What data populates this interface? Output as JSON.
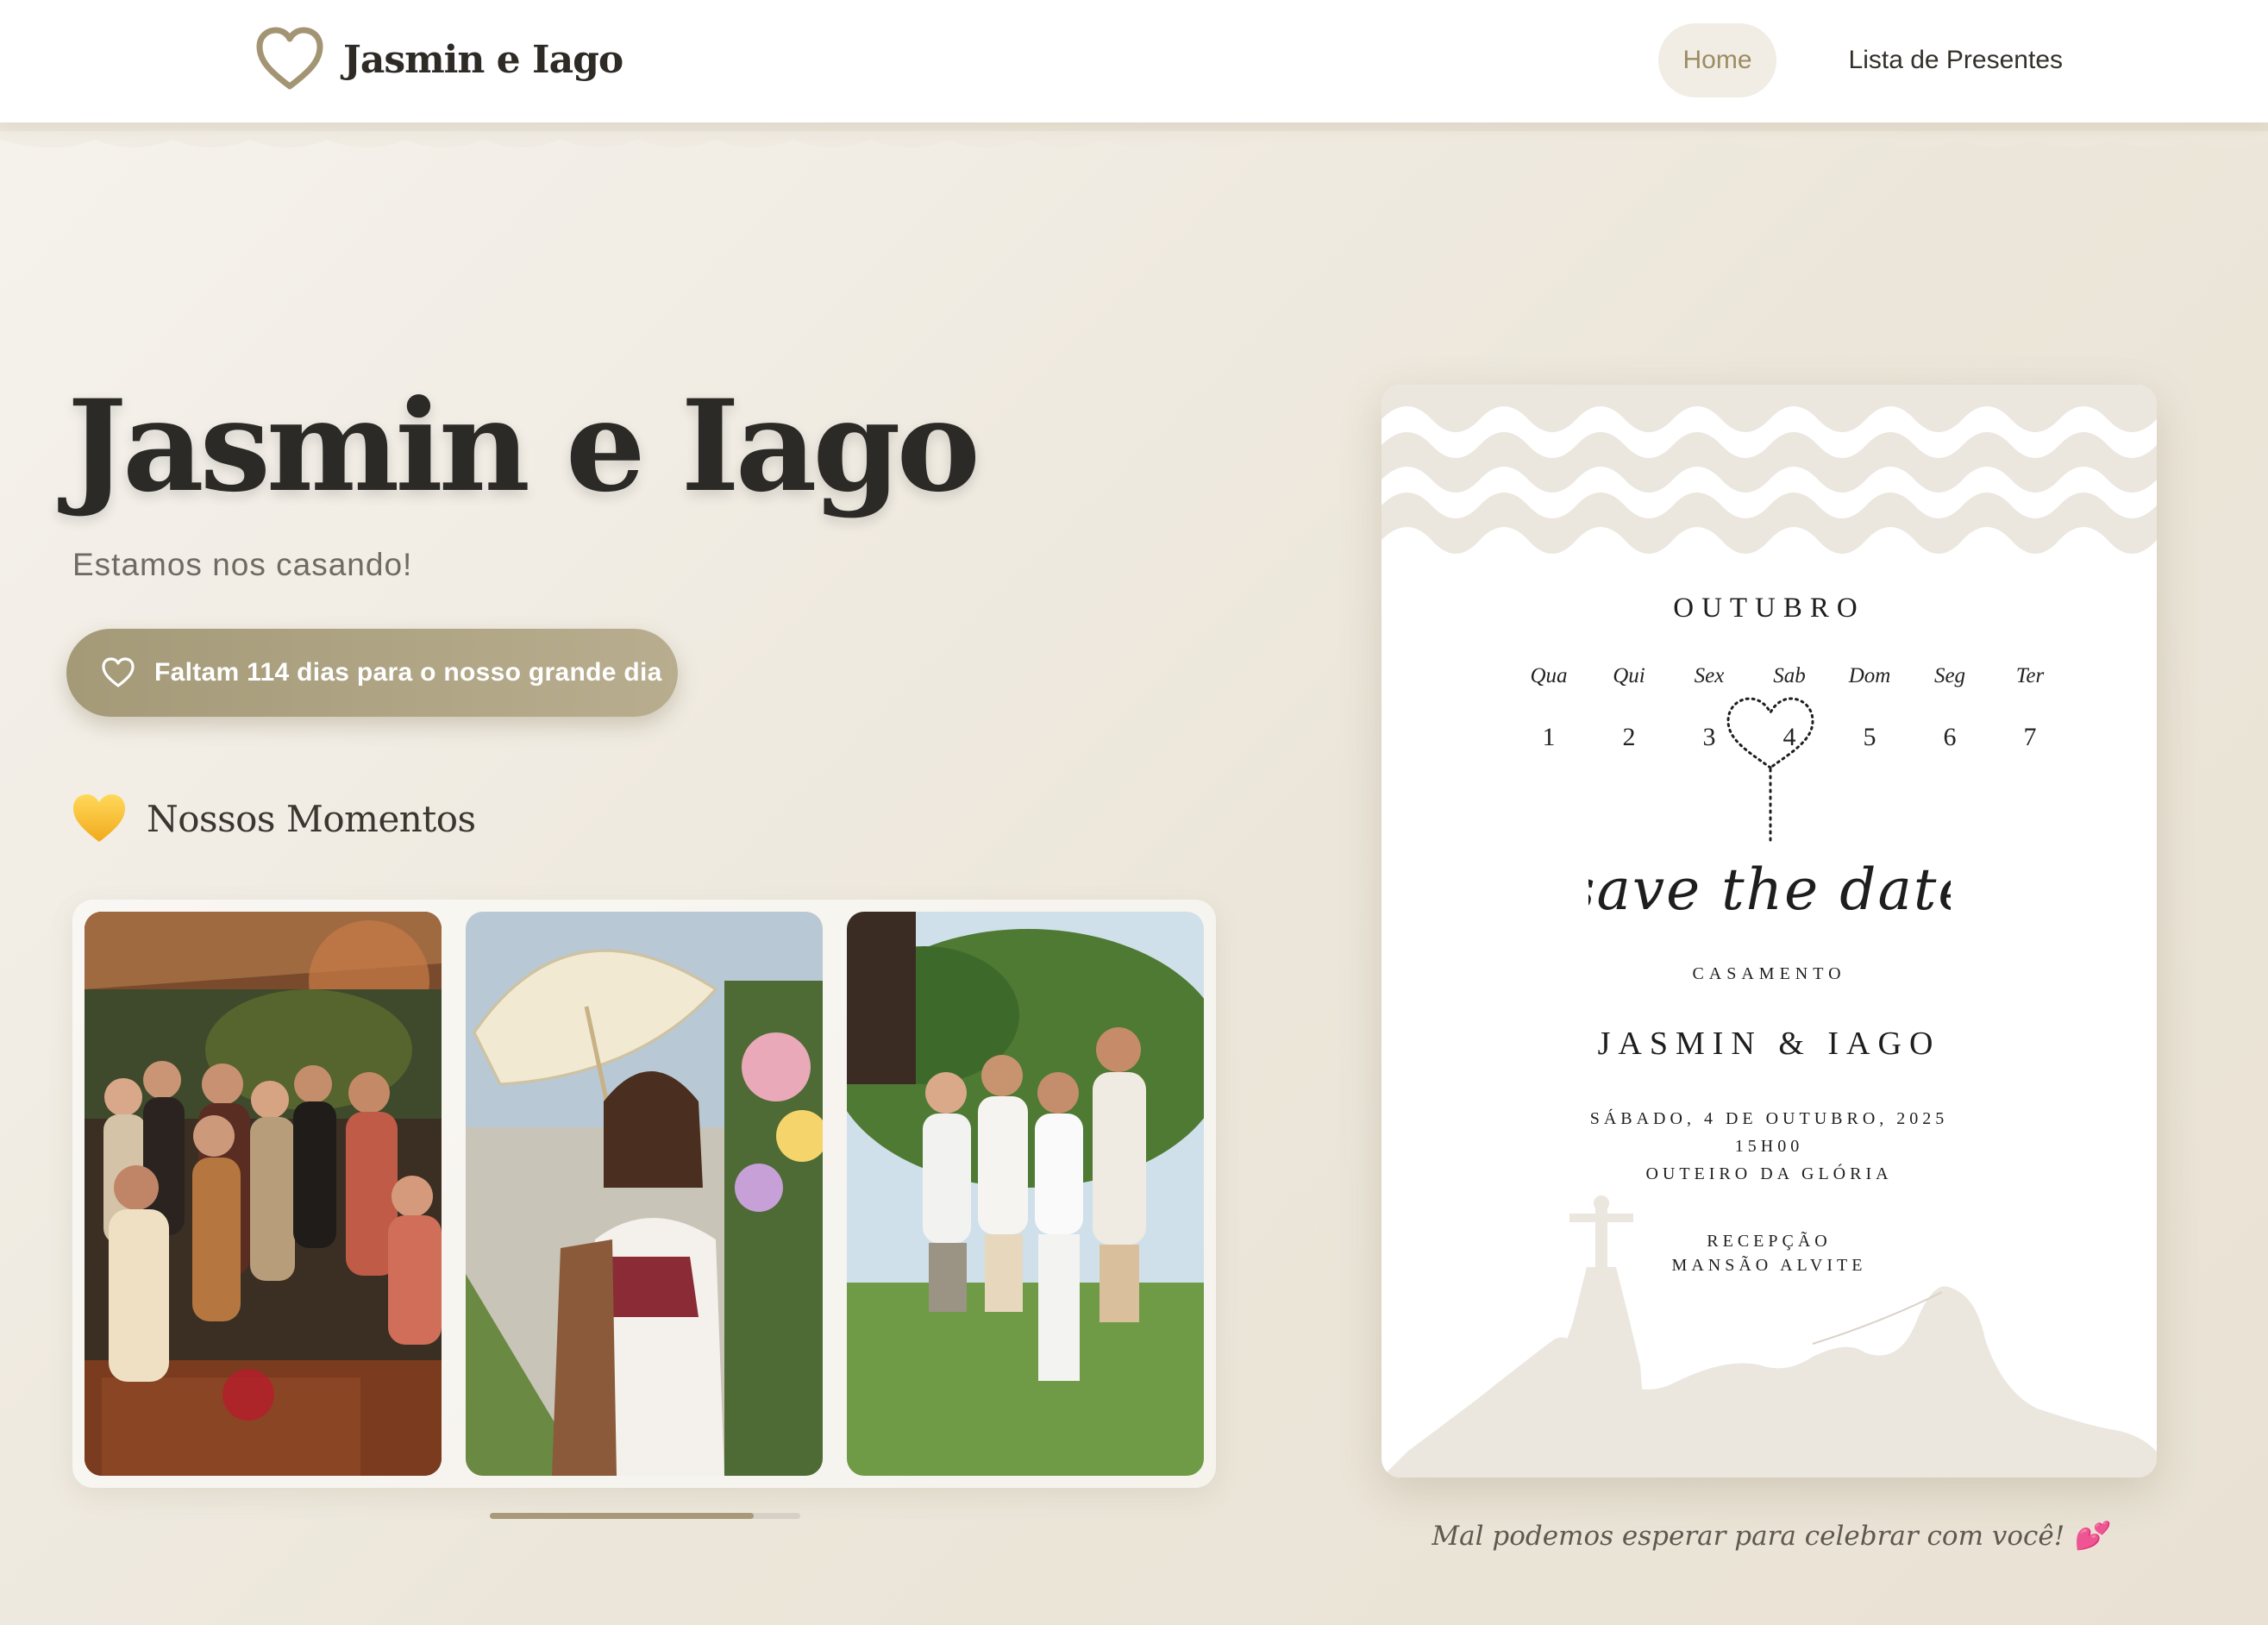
{
  "colors": {
    "accent": "#a49a78",
    "nav_active_text": "#9c8c62",
    "nav_active_bg": "#f1ede5",
    "background": "#ece6da"
  },
  "header": {
    "logo_icon": "heart-outline-icon",
    "brand": "Jasmin e Iago",
    "nav": [
      {
        "label": "Home",
        "active": true
      },
      {
        "label": "Lista de Presentes",
        "active": false
      }
    ]
  },
  "hero": {
    "title": "Jasmin e Iago",
    "subtitle": "Estamos nos casando!",
    "countdown": {
      "icon": "heart-outline-icon",
      "text": "Faltam 114 dias para o nosso grande dia"
    }
  },
  "moments": {
    "icon": "yellow-heart-icon",
    "title": "Nossos Momentos",
    "photos": [
      {
        "description": "group-photo-icon"
      },
      {
        "description": "woman-with-parasol-photo-icon"
      },
      {
        "description": "four-men-garden-photo-icon"
      }
    ],
    "scroll_progress": 0.85
  },
  "invitation": {
    "month": "OUTUBRO",
    "weekdays": [
      "Qua",
      "Qui",
      "Sex",
      "Sab",
      "Dom",
      "Seg",
      "Ter"
    ],
    "days": [
      "1",
      "2",
      "3",
      "4",
      "5",
      "6",
      "7"
    ],
    "highlighted_day": "4",
    "script_text": "save the date",
    "event": "CASAMENTO",
    "names": "JASMIN & IAGO",
    "date": "SÁBADO, 4 DE OUTUBRO, 2025",
    "time": "15H00",
    "ceremony_place": "OUTEIRO DA GLÓRIA",
    "reception_label": "RECEPÇÃO",
    "reception_place": "MANSÃO ALVITE"
  },
  "closing": "Mal podemos esperar para celebrar com você! 💕"
}
